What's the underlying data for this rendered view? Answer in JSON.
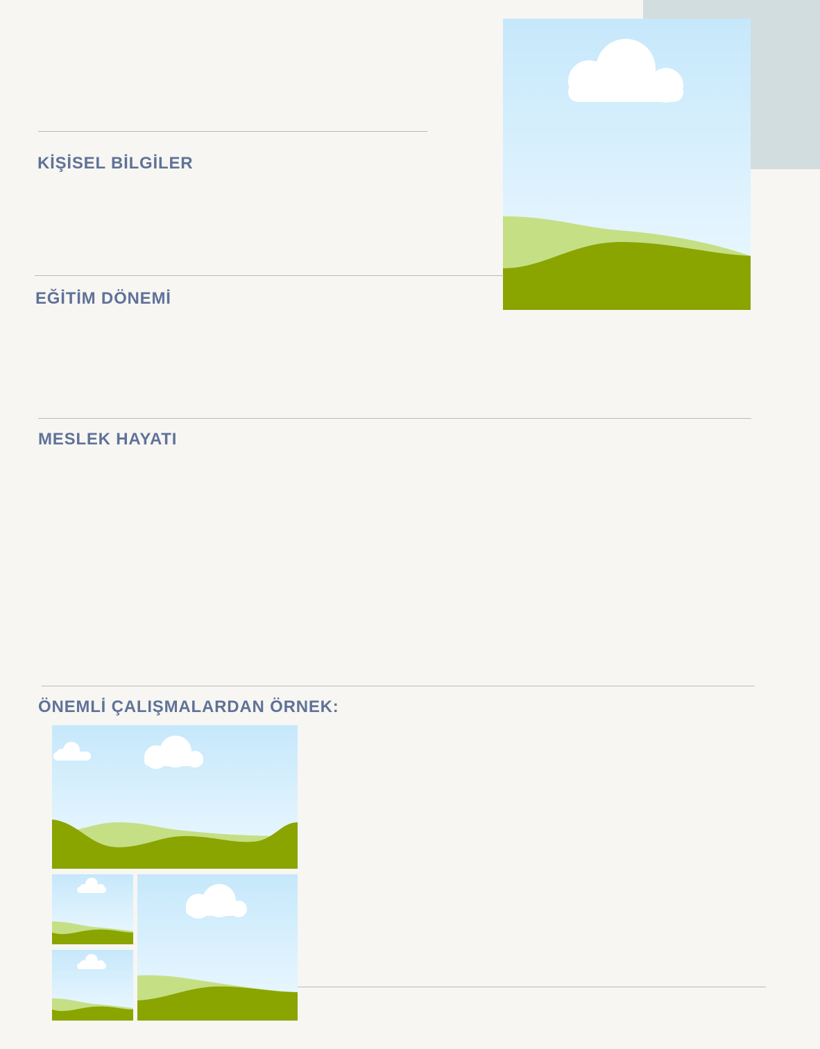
{
  "sections": {
    "personal": {
      "title": "KİŞİSEL BİLGİLER"
    },
    "education": {
      "title": "EĞİTİM DÖNEMİ"
    },
    "career": {
      "title": "MESLEK HAYATI"
    },
    "works": {
      "title": "ÖNEMLİ ÇALIŞMALARDAN ÖRNEK:"
    }
  },
  "placeholders": {
    "profile_photo": "image-placeholder-icon",
    "gallery": [
      "image-placeholder-icon",
      "image-placeholder-icon",
      "image-placeholder-icon",
      "image-placeholder-icon"
    ]
  },
  "colors": {
    "background": "#f7f6f2",
    "accent_block": "#d2dde0",
    "heading": "#5f7298",
    "divider": "#b9b9b9",
    "sky_top": "#c6e8fb",
    "sky_bottom": "#eef9ff",
    "hill_light": "#c5df85",
    "hill_dark": "#8aa400",
    "cloud": "#ffffff"
  }
}
